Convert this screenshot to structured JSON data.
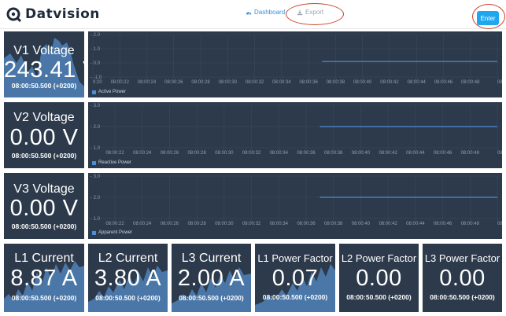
{
  "header": {
    "brand": "Datvision",
    "nav_dashboard": "Dashboard",
    "nav_export": "Export",
    "enter_label": "Enter",
    "accent": "#1ea6ee",
    "annotation_color": "#c9442b"
  },
  "voltage_cards": [
    {
      "title": "V1 Voltage",
      "value": "243.41 V",
      "timestamp": "08:00:50.500 (+0200)"
    },
    {
      "title": "V2 Voltage",
      "value": "0.00 V",
      "timestamp": "08:00:50.500 (+0200)"
    },
    {
      "title": "V3 Voltage",
      "value": "0.00 V",
      "timestamp": "08:00:50.500 (+0200)"
    }
  ],
  "bottom_cards": [
    {
      "title": "L1 Current",
      "value": "8.87 A",
      "timestamp": "08:00:50.500 (+0200)"
    },
    {
      "title": "L2 Current",
      "value": "3.80 A",
      "timestamp": "08:00:50.500 (+0200)"
    },
    {
      "title": "L3 Current",
      "value": "2.00 A",
      "timestamp": "08:00:50.500 (+0200)"
    },
    {
      "title": "L1 Power Factor",
      "value": "0.07",
      "timestamp": "08:00:50.500 (+0200)"
    },
    {
      "title": "L2 Power Factor",
      "value": "0.00",
      "timestamp": "08:00:50.500 (+0200)"
    },
    {
      "title": "L3 Power Factor",
      "value": "0.00",
      "timestamp": "08:00:50.500 (+0200)"
    }
  ],
  "chart_data": [
    {
      "type": "line",
      "series": [
        {
          "name": "Active Power",
          "x": [
            "08:00:37",
            "08:00:50"
          ],
          "values": [
            0.1,
            0.1
          ]
        }
      ],
      "x_ticks": [
        "0:20",
        "08:00:22",
        "08:00:24",
        "08:00:26",
        "08:00:28",
        "08:00:30",
        "08:00:32",
        "08:00:34",
        "08:00:36",
        "08:00:38",
        "08:00:40",
        "08:00:42",
        "08:00:44",
        "08:00:46",
        "08:00:48",
        "08:0"
      ],
      "y_ticks": [
        "2.0",
        "1.0",
        "0.0",
        "-1.0"
      ],
      "ylim": [
        -1.0,
        2.0
      ],
      "grid": true
    },
    {
      "type": "line",
      "series": [
        {
          "name": "Reactive Power",
          "x": [
            "08:00:37",
            "08:00:50"
          ],
          "values": [
            2.0,
            2.0
          ]
        }
      ],
      "x_ticks": [
        "08:00:22",
        "08:00:24",
        "08:00:26",
        "08:00:28",
        "08:00:30",
        "08:00:32",
        "08:00:34",
        "08:00:36",
        "08:00:38",
        "08:00:40",
        "08:00:42",
        "08:00:44",
        "08:00:46",
        "08:00:48",
        "08:0"
      ],
      "y_ticks": [
        "3.0",
        "2.0",
        "1.0"
      ],
      "ylim": [
        1.0,
        3.0
      ],
      "grid": true
    },
    {
      "type": "line",
      "series": [
        {
          "name": "Apparent Power",
          "x": [
            "08:00:37",
            "08:00:50"
          ],
          "values": [
            2.0,
            2.0
          ]
        }
      ],
      "x_ticks": [
        "08:00:22",
        "08:00:24",
        "08:00:26",
        "08:00:28",
        "08:00:30",
        "08:00:32",
        "08:00:34",
        "08:00:36",
        "08:00:38",
        "08:00:40",
        "08:00:42",
        "08:00:44",
        "08:00:46",
        "08:00:48",
        "08:0"
      ],
      "y_ticks": [
        "3.0",
        "2.0",
        "1.0"
      ],
      "ylim": [
        1.0,
        3.0
      ],
      "grid": true
    }
  ]
}
